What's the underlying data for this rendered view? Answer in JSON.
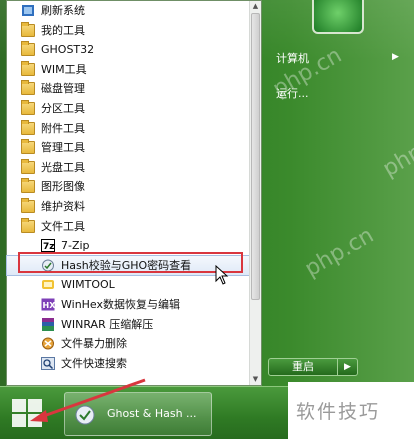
{
  "programs": {
    "items": [
      {
        "label": "刷新系统",
        "icon": "refresh-icon",
        "indent": false
      },
      {
        "label": "我的工具",
        "icon": "tool-icon",
        "indent": false
      },
      {
        "label": "GHOST32",
        "icon": "folder-icon",
        "indent": false
      },
      {
        "label": "WIM工具",
        "icon": "folder-icon",
        "indent": false
      },
      {
        "label": "磁盘管理",
        "icon": "folder-icon",
        "indent": false
      },
      {
        "label": "分区工具",
        "icon": "folder-icon",
        "indent": false
      },
      {
        "label": "附件工具",
        "icon": "folder-icon",
        "indent": false
      },
      {
        "label": "管理工具",
        "icon": "folder-icon",
        "indent": false
      },
      {
        "label": "光盘工具",
        "icon": "folder-icon",
        "indent": false
      },
      {
        "label": "图形图像",
        "icon": "folder-icon",
        "indent": false
      },
      {
        "label": "维护资料",
        "icon": "folder-icon",
        "indent": false
      },
      {
        "label": "文件工具",
        "icon": "folder-icon",
        "indent": false
      },
      {
        "label": "7-Zip",
        "icon": "7zip-icon",
        "indent": true
      },
      {
        "label": "Hash校验与GHO密码查看",
        "icon": "hash-icon",
        "indent": true,
        "selected": true
      },
      {
        "label": "WIMTOOL",
        "icon": "wimtool-icon",
        "indent": true
      },
      {
        "label": "WinHex数据恢复与编辑",
        "icon": "winhex-icon",
        "indent": true
      },
      {
        "label": "WINRAR 压缩解压",
        "icon": "winrar-icon",
        "indent": true
      },
      {
        "label": "文件暴力删除",
        "icon": "delete-icon",
        "indent": true
      },
      {
        "label": "文件快速搜索",
        "icon": "search-icon",
        "indent": true
      }
    ]
  },
  "right_pane": {
    "computer_label": "计算机",
    "run_label": "运行...",
    "restart_label": "重启"
  },
  "taskbar": {
    "task_label": "Ghost & Hash ..."
  },
  "watermark": {
    "site": "php.cn",
    "caption": "软件技巧"
  },
  "colors": {
    "frame_green": "#2a7a22",
    "highlight_red": "#d9363e",
    "selection_blue": "#dfe9f7"
  }
}
